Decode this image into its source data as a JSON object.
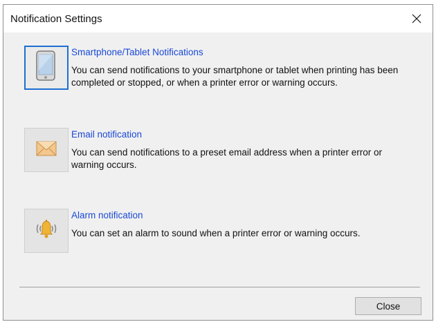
{
  "window": {
    "title": "Notification Settings",
    "close_icon": "close-icon"
  },
  "options": [
    {
      "icon": "smartphone-icon",
      "title": "Smartphone/Tablet Notifications",
      "description": "You can send notifications to your smartphone or tablet when printing has been completed or stopped, or when a printer error or warning occurs.",
      "selected": true
    },
    {
      "icon": "envelope-icon",
      "title": "Email notification",
      "description": "You can send notifications to a preset email address when a printer error or warning occurs.",
      "selected": false
    },
    {
      "icon": "alarm-bell-icon",
      "title": "Alarm notification",
      "description": "You can set an alarm to sound when a printer error or warning occurs.",
      "selected": false
    }
  ],
  "footer": {
    "close_label": "Close"
  },
  "colors": {
    "link_blue": "#1a49d6",
    "focus_blue": "#1c6fd1",
    "dialog_bg": "#f0f0f0"
  }
}
